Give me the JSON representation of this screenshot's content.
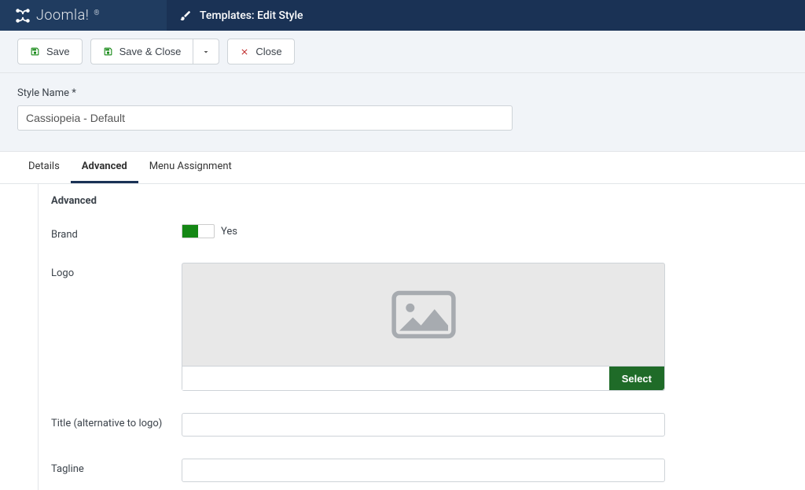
{
  "header": {
    "brand": "Joomla!",
    "page_title": "Templates: Edit Style"
  },
  "toolbar": {
    "save": "Save",
    "save_close": "Save & Close",
    "close": "Close"
  },
  "style_name": {
    "label": "Style Name *",
    "value": "Cassiopeia - Default"
  },
  "tabs": [
    {
      "label": "Details",
      "active": false
    },
    {
      "label": "Advanced",
      "active": true
    },
    {
      "label": "Menu Assignment",
      "active": false
    }
  ],
  "fieldset": {
    "legend": "Advanced",
    "fields": {
      "brand": {
        "label": "Brand",
        "value": "Yes"
      },
      "logo": {
        "label": "Logo",
        "select_btn": "Select",
        "path": ""
      },
      "title": {
        "label": "Title (alternative to logo)",
        "value": ""
      },
      "tagline": {
        "label": "Tagline",
        "value": ""
      }
    }
  }
}
